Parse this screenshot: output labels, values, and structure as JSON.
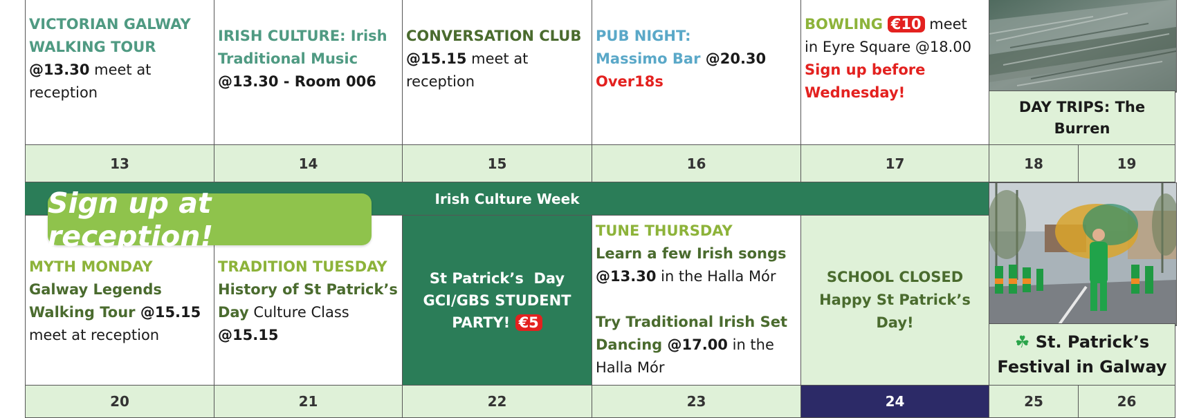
{
  "row1": {
    "mon": {
      "title": "VICTORIAN GALWAY WALKING TOUR",
      "time": "@13.30",
      "rest": " meet at reception"
    },
    "tue": {
      "title": "IRISH CULTURE: Irish Traditional Music",
      "time": "@13.30 - Room 006"
    },
    "wed": {
      "title": "CONVERSATION CLUB",
      "time": "@15.15",
      "rest": " meet at reception"
    },
    "thu": {
      "title": "PUB NIGHT:",
      "venue": "Massimo Bar",
      "time": " @20.30",
      "note": "Over18s"
    },
    "fri": {
      "title": "BOWLING",
      "badge": "€10",
      "rest": " meet in Eyre Square @18.00",
      "note": "Sign up before Wednesday!"
    },
    "trip": {
      "label": "DAY TRIPS: The Burren",
      "photo": "burren-limestone-photo"
    }
  },
  "dates1": [
    "13",
    "14",
    "15",
    "16",
    "17",
    "18",
    "19"
  ],
  "banner": "Irish Culture Week",
  "signup": "Sign up at reception!",
  "row2": {
    "mon": {
      "title": "MYTH MONDAY",
      "sub": "Galway Legends Walking Tour",
      "time": " @15.15",
      "rest": " meet at reception"
    },
    "tue": {
      "title": "TRADITION TUESDAY",
      "sub": "History of St Patrick’s Day",
      "rest": " Culture Class",
      "time": "@15.15"
    },
    "wed": {
      "line1": "St Patrick’s  Day",
      "line2": "GCI/GBS STUDENT",
      "line3": "PARTY!",
      "badge": "€5"
    },
    "thu": {
      "title": "TUNE THURSDAY",
      "sub1": "Learn a few Irish songs",
      "time1": "@13.30",
      "rest1": " in the Halla Mór",
      "sub2": "Try Traditional Irish Set Dancing",
      "time2": " @17.00",
      "rest2": " in the Halla Mór"
    },
    "fri": {
      "line1": "SCHOOL CLOSED",
      "line2": "Happy St Patrick’s Day!"
    },
    "fest": {
      "icon": "☘",
      "label": "St. Patrick’s Festival in Galway",
      "photo": "parade-photo"
    }
  },
  "dates2": [
    "20",
    "21",
    "22",
    "23",
    "24",
    "25",
    "26"
  ],
  "colors": {
    "banner": "#2b7d58",
    "date_bg": "#dff1d8",
    "navy": "#2c2a67",
    "signup": "#8fc34c",
    "badge": "#e3211f"
  }
}
